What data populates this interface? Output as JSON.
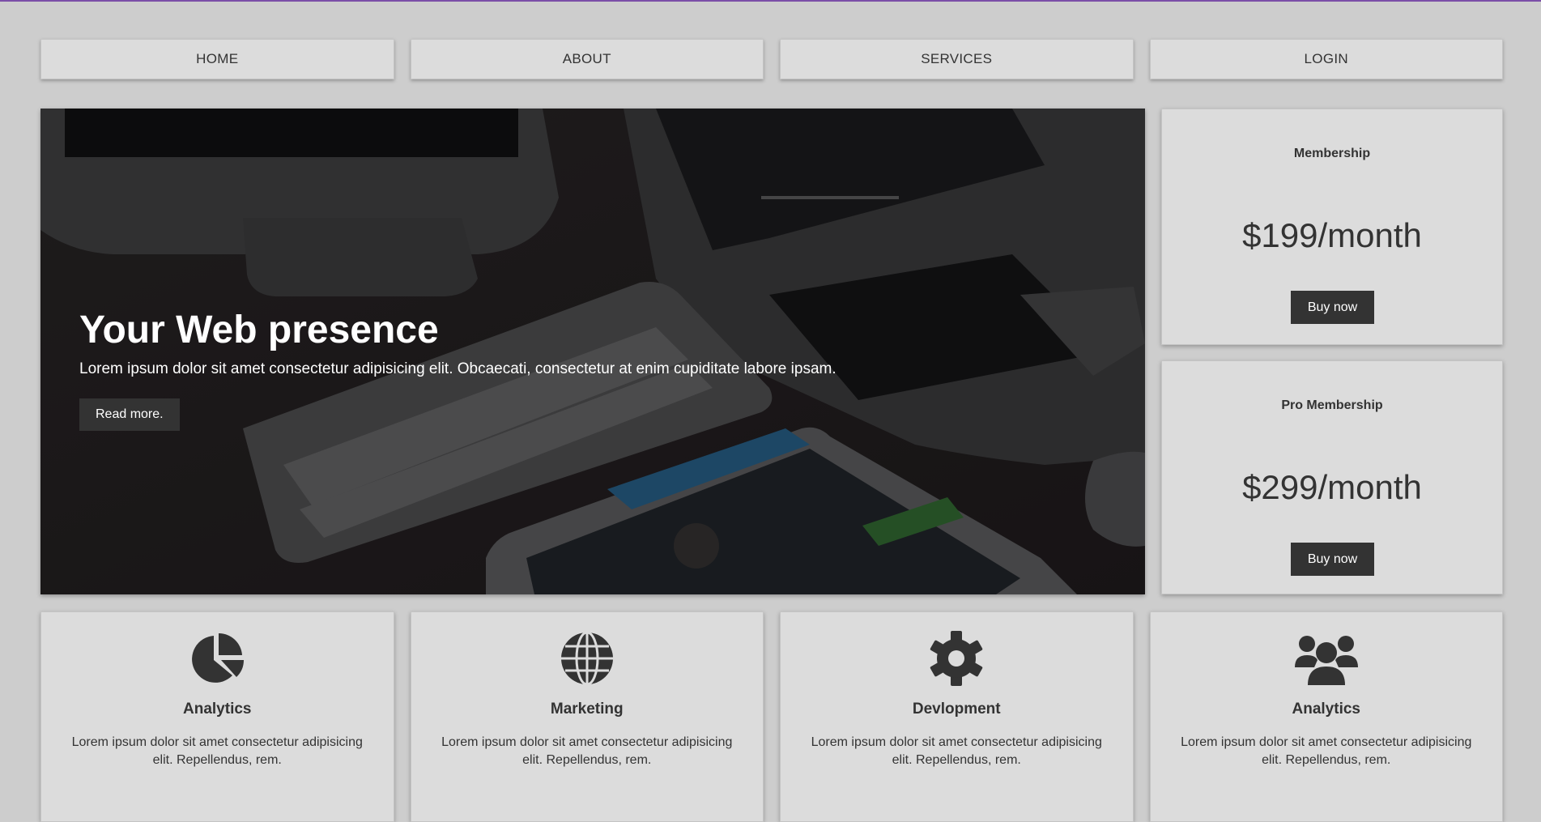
{
  "nav": {
    "items": [
      "HOME",
      "ABOUT",
      "SERVICES",
      "LOGIN"
    ]
  },
  "hero": {
    "title": "Your Web presence",
    "text": "Lorem ipsum dolor sit amet consectetur adipisicing elit. Obcaecati, consectetur at enim cupiditate labore ipsam.",
    "button": "Read more."
  },
  "plans": [
    {
      "title": "Membership",
      "price": "$199/month",
      "button": "Buy now"
    },
    {
      "title": "Pro Membership",
      "price": "$299/month",
      "button": "Buy now"
    }
  ],
  "features": [
    {
      "icon": "pie-chart-icon",
      "title": "Analytics",
      "text": "Lorem ipsum dolor sit amet consectetur adipisicing elit. Repellendus, rem."
    },
    {
      "icon": "globe-icon",
      "title": "Marketing",
      "text": "Lorem ipsum dolor sit amet consectetur adipisicing elit. Repellendus, rem."
    },
    {
      "icon": "gear-icon",
      "title": "Devlopment",
      "text": "Lorem ipsum dolor sit amet consectetur adipisicing elit. Repellendus, rem."
    },
    {
      "icon": "users-icon",
      "title": "Analytics",
      "text": "Lorem ipsum dolor sit amet consectetur adipisicing elit. Repellendus, rem."
    }
  ],
  "colors": {
    "accent_bar": "#7b4ea8",
    "background": "#cdcdcd",
    "card": "#dcdcdc",
    "button": "#333333"
  }
}
